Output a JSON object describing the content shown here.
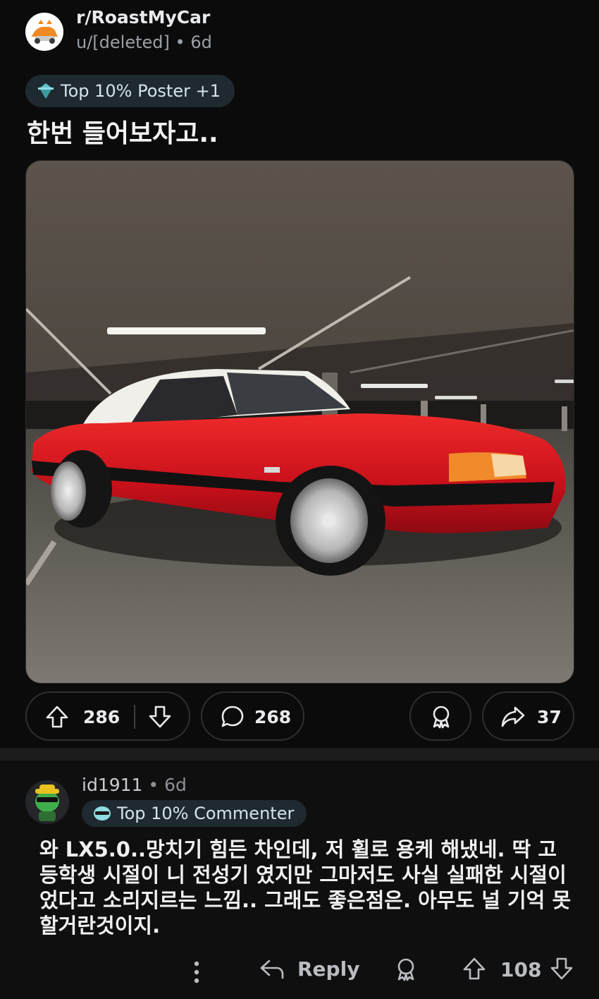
{
  "post": {
    "subreddit": "r/RoastMyCar",
    "author": "u/[deleted]",
    "separator": "•",
    "age": "6d",
    "flair": "Top 10% Poster +1",
    "title": "한번 들어보자고..",
    "upvotes": "286",
    "comments": "268",
    "shares": "37"
  },
  "comment": {
    "author": "id1911",
    "separator": "•",
    "age": "6d",
    "flair": "Top 10% Commenter",
    "body": "와 LX5.0..망치기 힘든 차인데, 저 휠로 용케 해냈네. 딱 고등학생 시절이 니 전성기 였지만 그마저도 사실 실패한 시절이었다고 소리지르는 느낌.. 그래도 좋은점은. 아무도 널 기억 못할거란것이지.",
    "reply_label": "Reply",
    "score": "108"
  },
  "colors": {
    "background": "#0b0b0b",
    "flair_bg": "#1e2a30",
    "car_red": "#d8141b"
  }
}
